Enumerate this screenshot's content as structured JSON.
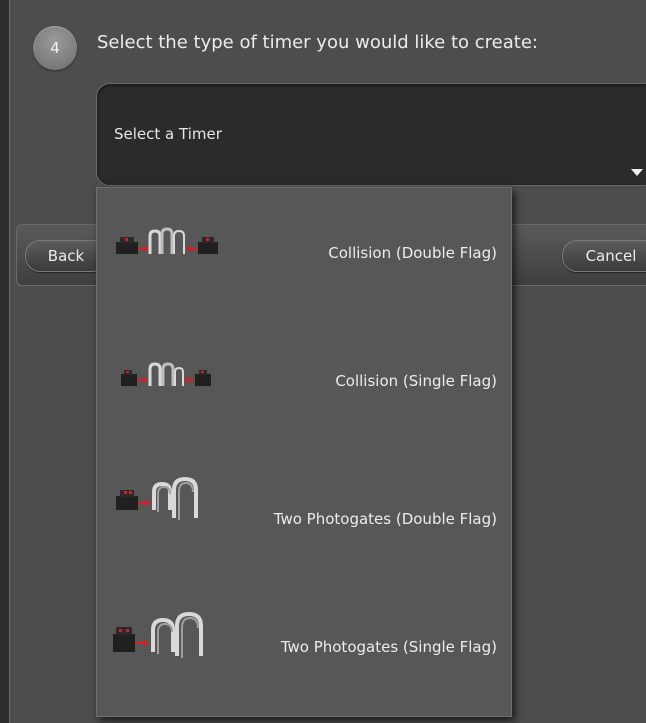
{
  "step": {
    "number": "4",
    "title": "Select the type of timer you would like to create:"
  },
  "select": {
    "value": "Select a Timer"
  },
  "buttons": {
    "back": "Back",
    "cancel": "Cancel"
  },
  "options": [
    {
      "label": "Collision (Double Flag)",
      "icon": "collision-double-flag-icon"
    },
    {
      "label": "Collision (Single Flag)",
      "icon": "collision-single-flag-icon"
    },
    {
      "label": "Two Photogates (Double Flag)",
      "icon": "two-photogates-double-flag-icon"
    },
    {
      "label": "Two Photogates (Single Flag)",
      "icon": "two-photogates-single-flag-icon"
    }
  ],
  "colors": {
    "background": "#4d4d4d",
    "dropdown": "#575757",
    "select_box": "#2b2b2b",
    "accent_red": "#d21f26"
  }
}
